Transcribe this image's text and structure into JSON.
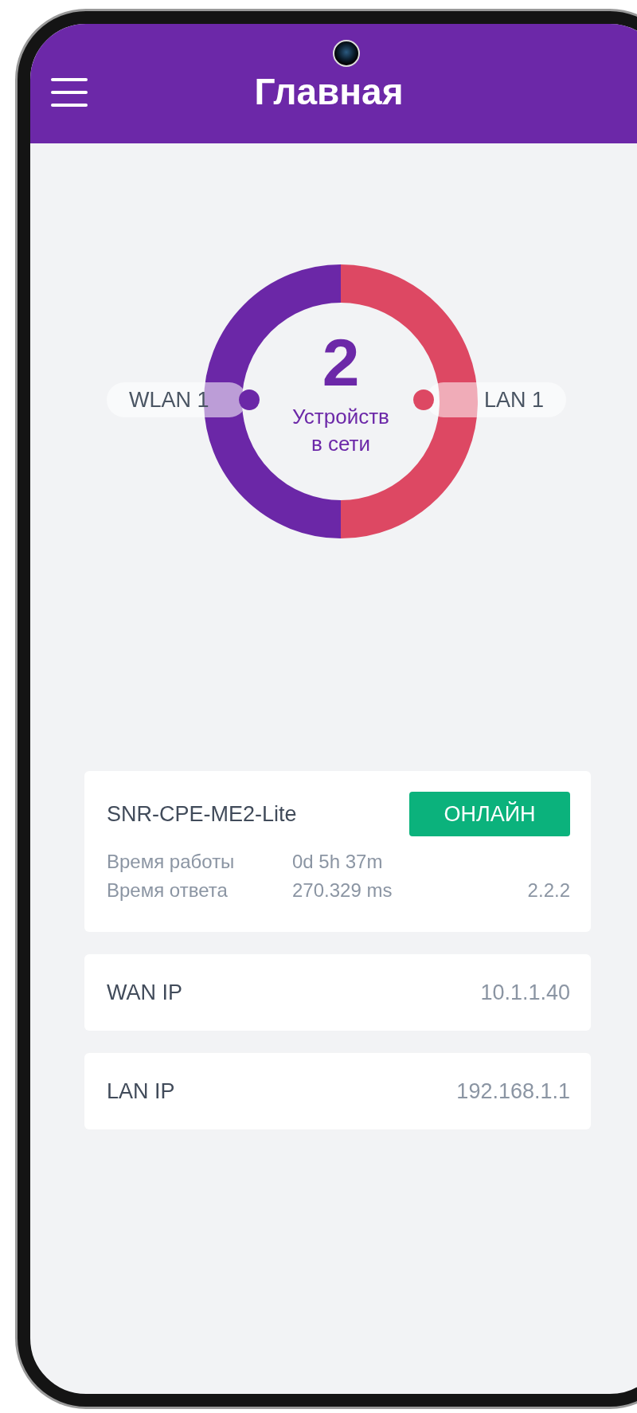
{
  "header": {
    "title": "Главная"
  },
  "devices": {
    "count": "2",
    "caption": "Устройств в сети",
    "segments": [
      {
        "label": "WLAN 1",
        "color": "#6b27a7"
      },
      {
        "label": "LAN 1",
        "color": "#dd4863"
      }
    ]
  },
  "router": {
    "name": "SNR-CPE-ME2-Lite",
    "status": "ОНЛАЙН",
    "online": true,
    "rows": [
      {
        "label": "Время работы",
        "value": "0d 5h 37m"
      },
      {
        "label": "Время ответа",
        "value": "270.329 ms",
        "extra": "2.2.2"
      }
    ]
  },
  "addresses": [
    {
      "label": "WAN IP",
      "value": "10.1.1.40"
    },
    {
      "label": "LAN IP",
      "value": "192.168.1.1"
    }
  ]
}
